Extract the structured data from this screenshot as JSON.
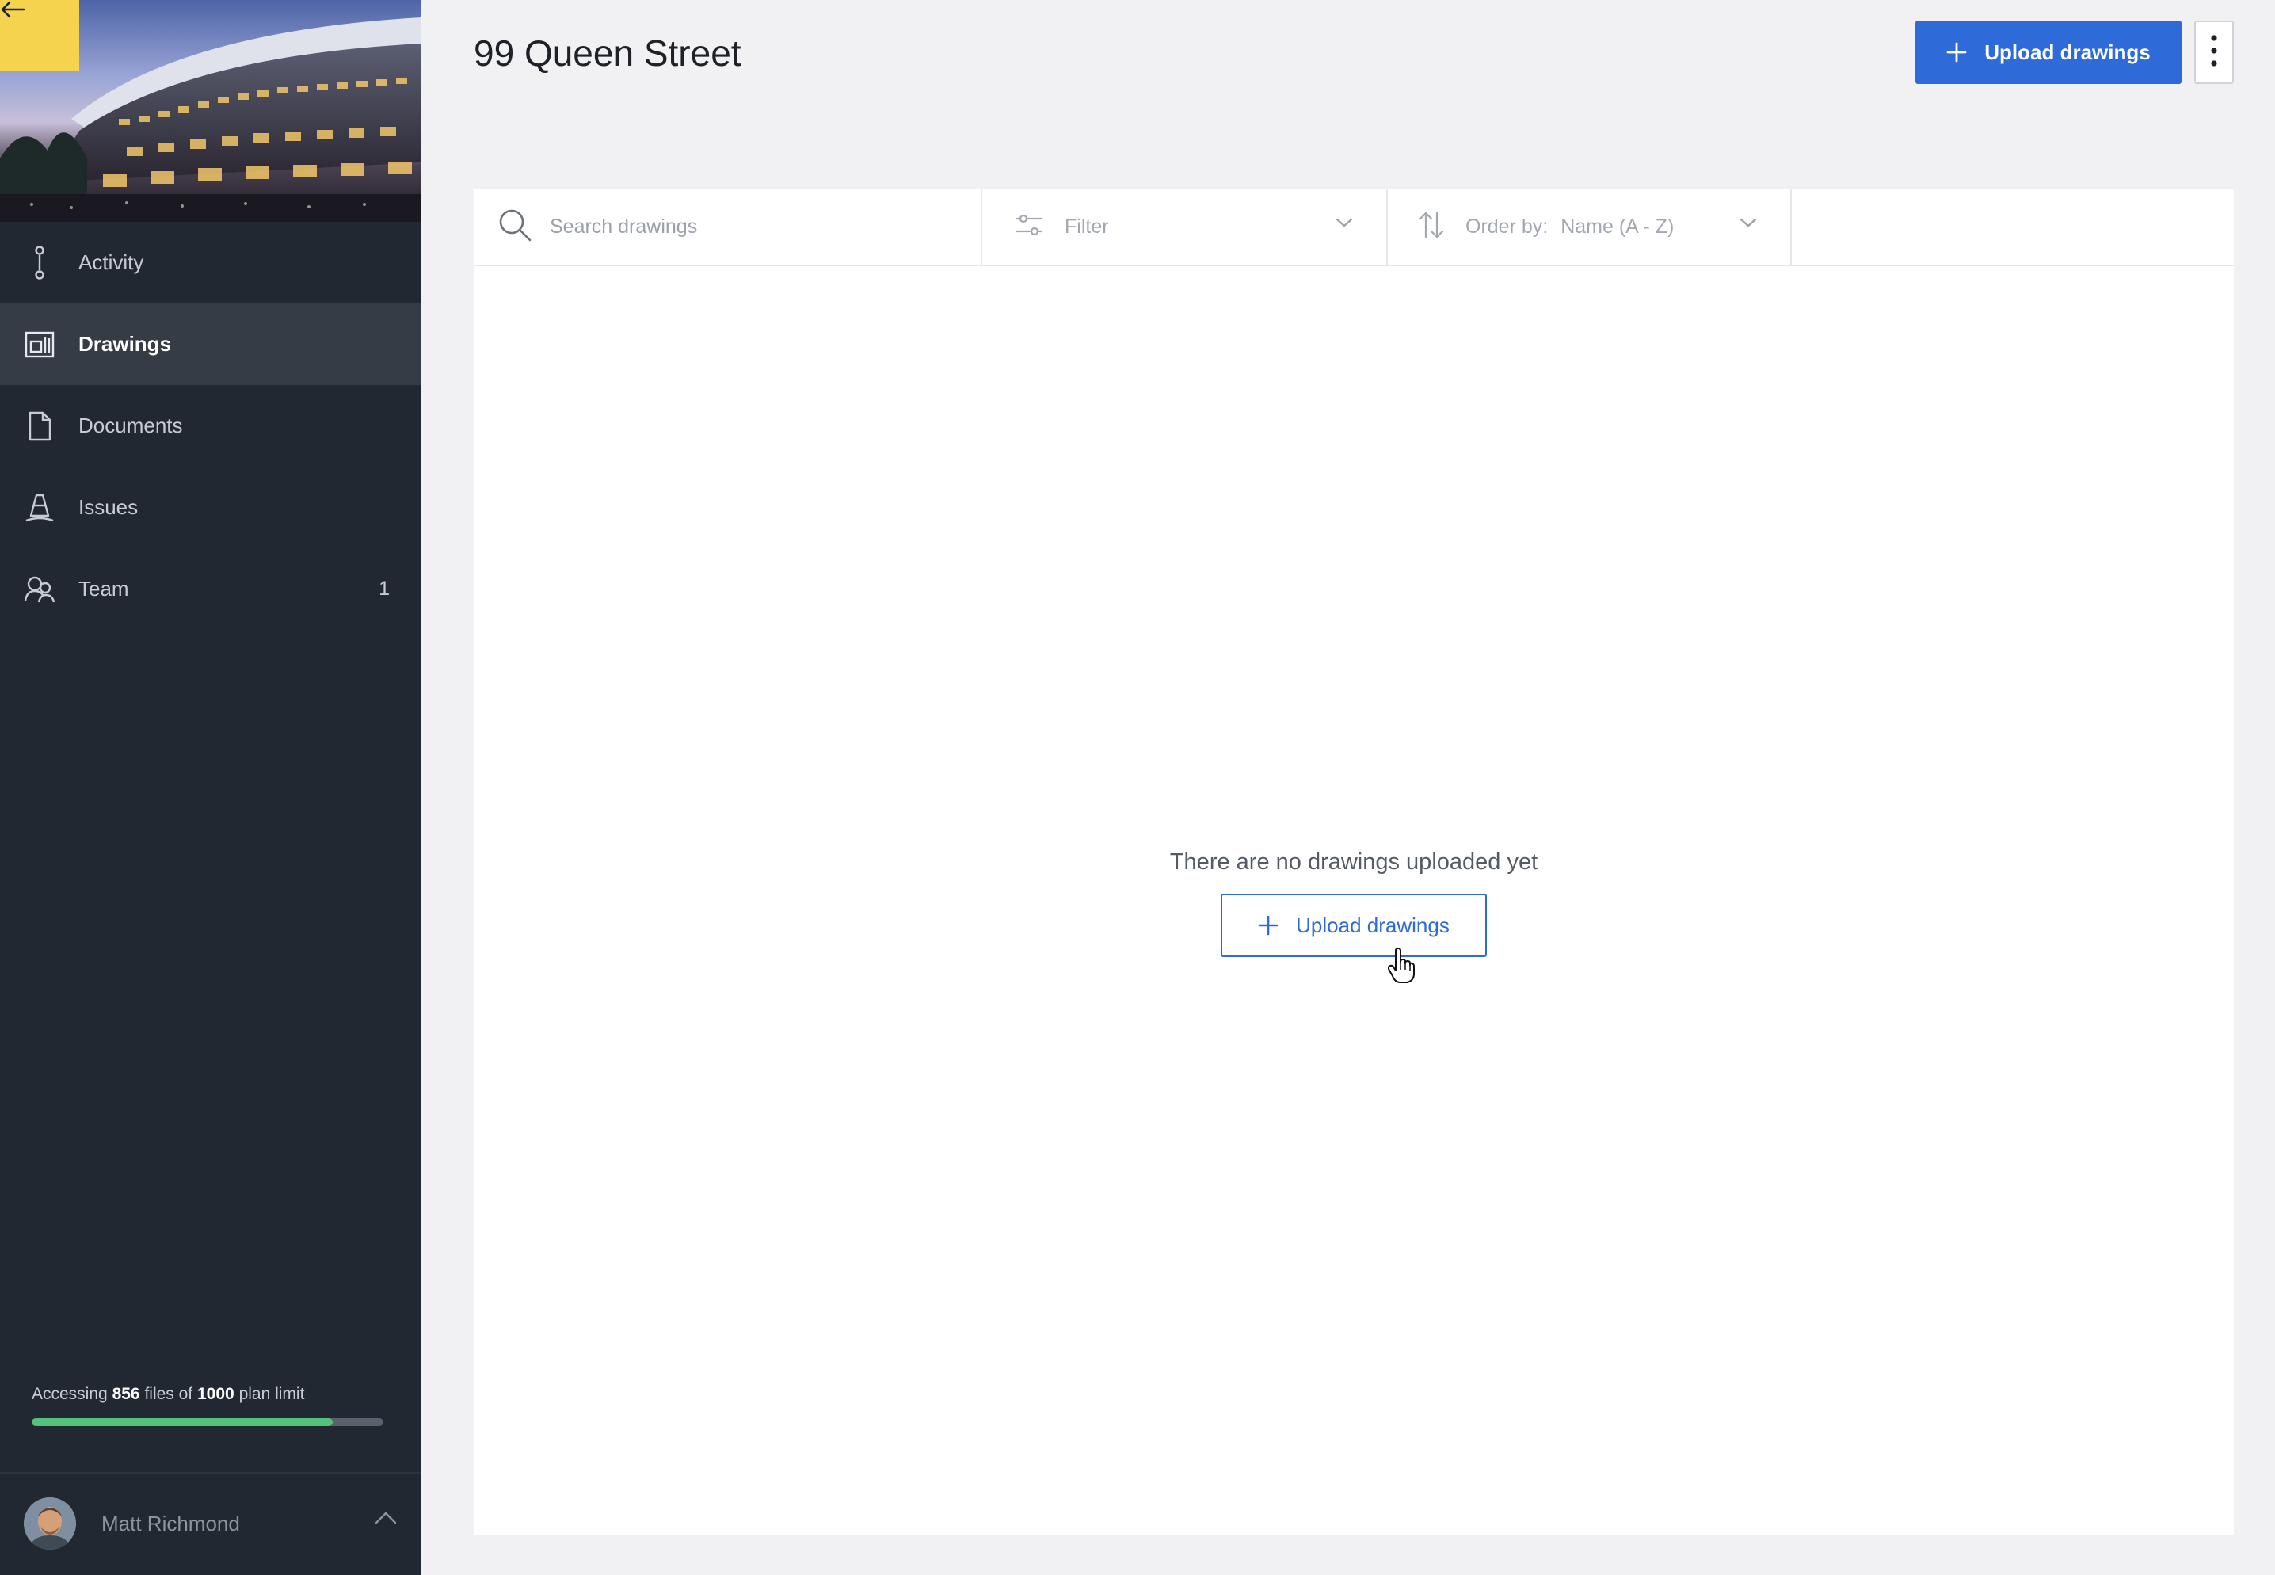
{
  "sidebar": {
    "nav": [
      {
        "label": "Activity",
        "icon": "activity-icon",
        "count": null,
        "active": false
      },
      {
        "label": "Drawings",
        "icon": "drawings-icon",
        "count": null,
        "active": true
      },
      {
        "label": "Documents",
        "icon": "document-icon",
        "count": null,
        "active": false
      },
      {
        "label": "Issues",
        "icon": "cone-icon",
        "count": null,
        "active": false
      },
      {
        "label": "Team",
        "icon": "team-icon",
        "count": "1",
        "active": false
      }
    ],
    "quota": {
      "prefix": "Accessing",
      "used": "856",
      "middle": "files of",
      "limit": "1000",
      "suffix": "plan limit",
      "fraction": 0.856
    },
    "user": {
      "name": "Matt Richmond"
    }
  },
  "header": {
    "title": "99 Queen Street",
    "upload_label": "Upload drawings"
  },
  "toolbar": {
    "search_placeholder": "Search drawings",
    "filter_label": "Filter",
    "order_label": "Order by:",
    "order_value": "Name (A - Z)"
  },
  "empty_state": {
    "message": "There are no drawings uploaded yet",
    "upload_label": "Upload drawings"
  },
  "colors": {
    "sidebar_bg": "#222831",
    "accent": "#2f6bd8",
    "back_button": "#f5d34e",
    "quota_fill": "#52c27a"
  }
}
